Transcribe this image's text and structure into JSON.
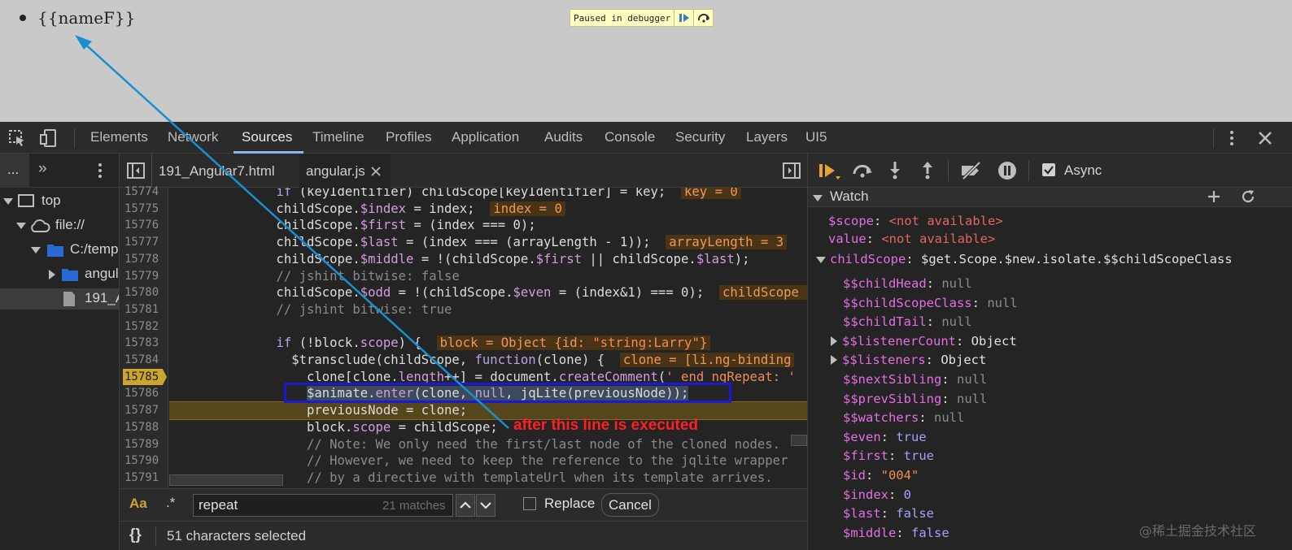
{
  "page": {
    "list_item_text": "{{nameF}}",
    "paused_banner": "Paused in debugger"
  },
  "devtools": {
    "main_tabs": [
      "Elements",
      "Network",
      "Sources",
      "Timeline",
      "Profiles",
      "Application",
      "Audits",
      "Console",
      "Security",
      "Layers",
      "UI5"
    ],
    "active_tab": "Sources"
  },
  "navigator": {
    "menu_label": "...",
    "more_label": "»",
    "tree": [
      {
        "label": "top"
      },
      {
        "label": "file://"
      },
      {
        "label": "C:/temp"
      },
      {
        "label": "angul"
      },
      {
        "label": "191_A"
      }
    ]
  },
  "editor": {
    "file_tabs": [
      "191_Angular7.html",
      "angular.js"
    ],
    "active_file": "angular.js",
    "paused_line": "15785",
    "current_line": "15787",
    "line_numbers": [
      "15774",
      "15775",
      "15776",
      "15777",
      "15778",
      "15779",
      "15780",
      "15781",
      "15782",
      "15783",
      "15784",
      "15785",
      "15786",
      "15787",
      "15788",
      "15789",
      "15790",
      "15791"
    ],
    "annotation": "after this line is executed"
  },
  "search": {
    "case_label": "Aa",
    "regex_label": ".*",
    "query": "repeat",
    "matches": "21 matches",
    "replace_label": "Replace",
    "cancel_label": "Cancel"
  },
  "status": {
    "braces_label": "{}",
    "selection_text": "51 characters selected"
  },
  "debugger": {
    "async_label": "Async",
    "async_checked": true,
    "watch_title": "Watch",
    "watch": [
      {
        "name": "$scope",
        "value": "<not available>"
      },
      {
        "name": "value",
        "value": "<not available>"
      }
    ],
    "child_scope": {
      "name": "childScope",
      "value": "$get.Scope.$new.isolate.$$childScopeClass",
      "props": [
        {
          "name": "$$childHead",
          "value": "null",
          "kind": "null",
          "expandable": false
        },
        {
          "name": "$$childScopeClass",
          "value": "null",
          "kind": "null",
          "expandable": false
        },
        {
          "name": "$$childTail",
          "value": "null",
          "kind": "null",
          "expandable": false
        },
        {
          "name": "$$listenerCount",
          "value": "Object",
          "kind": "plain",
          "expandable": true
        },
        {
          "name": "$$listeners",
          "value": "Object",
          "kind": "plain",
          "expandable": true
        },
        {
          "name": "$$nextSibling",
          "value": "null",
          "kind": "null",
          "expandable": false
        },
        {
          "name": "$$prevSibling",
          "value": "null",
          "kind": "null",
          "expandable": false
        },
        {
          "name": "$$watchers",
          "value": "null",
          "kind": "null",
          "expandable": false
        },
        {
          "name": "$even",
          "value": "true",
          "kind": "num",
          "expandable": false
        },
        {
          "name": "$first",
          "value": "true",
          "kind": "num",
          "expandable": false
        },
        {
          "name": "$id",
          "value": "\"004\"",
          "kind": "str",
          "expandable": false
        },
        {
          "name": "$index",
          "value": "0",
          "kind": "num",
          "expandable": false
        },
        {
          "name": "$last",
          "value": "false",
          "kind": "num",
          "expandable": false
        },
        {
          "name": "$middle",
          "value": "false",
          "kind": "num",
          "expandable": false
        }
      ]
    }
  },
  "watermark": "@稀土掘金技术社区",
  "colors": {
    "accent": "#8ab4f8",
    "breakpoint": "#cca42e",
    "annotation": "#ff2020",
    "box": "#1a1ad6",
    "arrow": "#1a8fd0"
  }
}
